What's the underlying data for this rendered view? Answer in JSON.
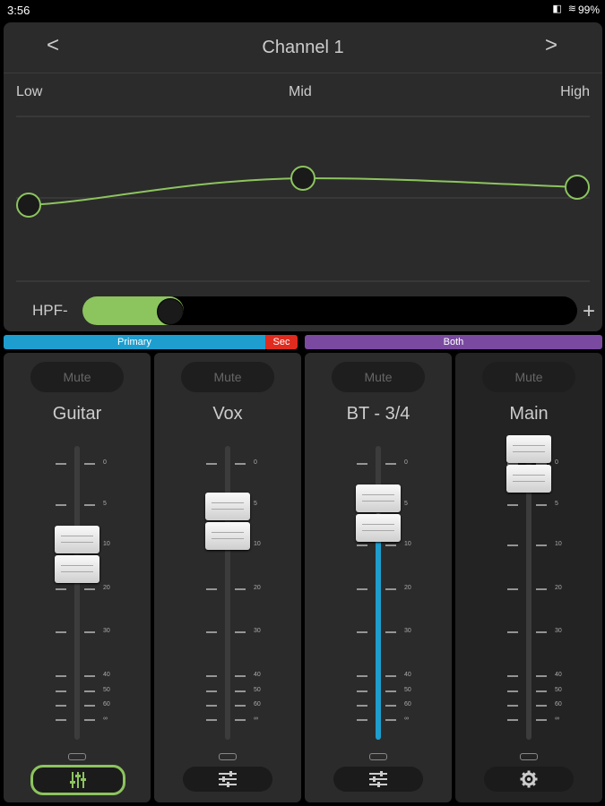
{
  "status": {
    "time": "3:56",
    "battery": "99%"
  },
  "eq": {
    "title": "Channel 1",
    "prev": "<",
    "next": ">",
    "bands": {
      "low": "Low",
      "mid": "Mid",
      "high": "High"
    },
    "hpf": {
      "label": "HPF",
      "minus": "-",
      "plus": "+",
      "value_fraction": 0.15
    },
    "accent": "#8cc45e"
  },
  "buses": {
    "primary": "Primary",
    "sec": "Sec",
    "both": "Both",
    "colors": {
      "primary": "#1e9ecf",
      "sec": "#e02b1e",
      "both": "#7a4aa0"
    }
  },
  "scale_labels": [
    "0",
    "5",
    "10",
    "20",
    "30",
    "40",
    "50",
    "60",
    "∞"
  ],
  "strips": [
    {
      "name": "Guitar",
      "mute": "Mute",
      "fader_db": 12,
      "show_level": false,
      "button_icon": "faders-icon",
      "button_active": true
    },
    {
      "name": "Vox",
      "mute": "Mute",
      "fader_db": 7,
      "show_level": false,
      "button_icon": "sliders-icon",
      "button_active": false
    },
    {
      "name": "BT - 3/4",
      "mute": "Mute",
      "fader_db": 6,
      "show_level": true,
      "button_icon": "sliders-icon",
      "button_active": false
    },
    {
      "name": "Main",
      "mute": "Mute",
      "fader_db": 0,
      "show_level": false,
      "button_icon": "gear-icon",
      "button_active": false
    }
  ]
}
